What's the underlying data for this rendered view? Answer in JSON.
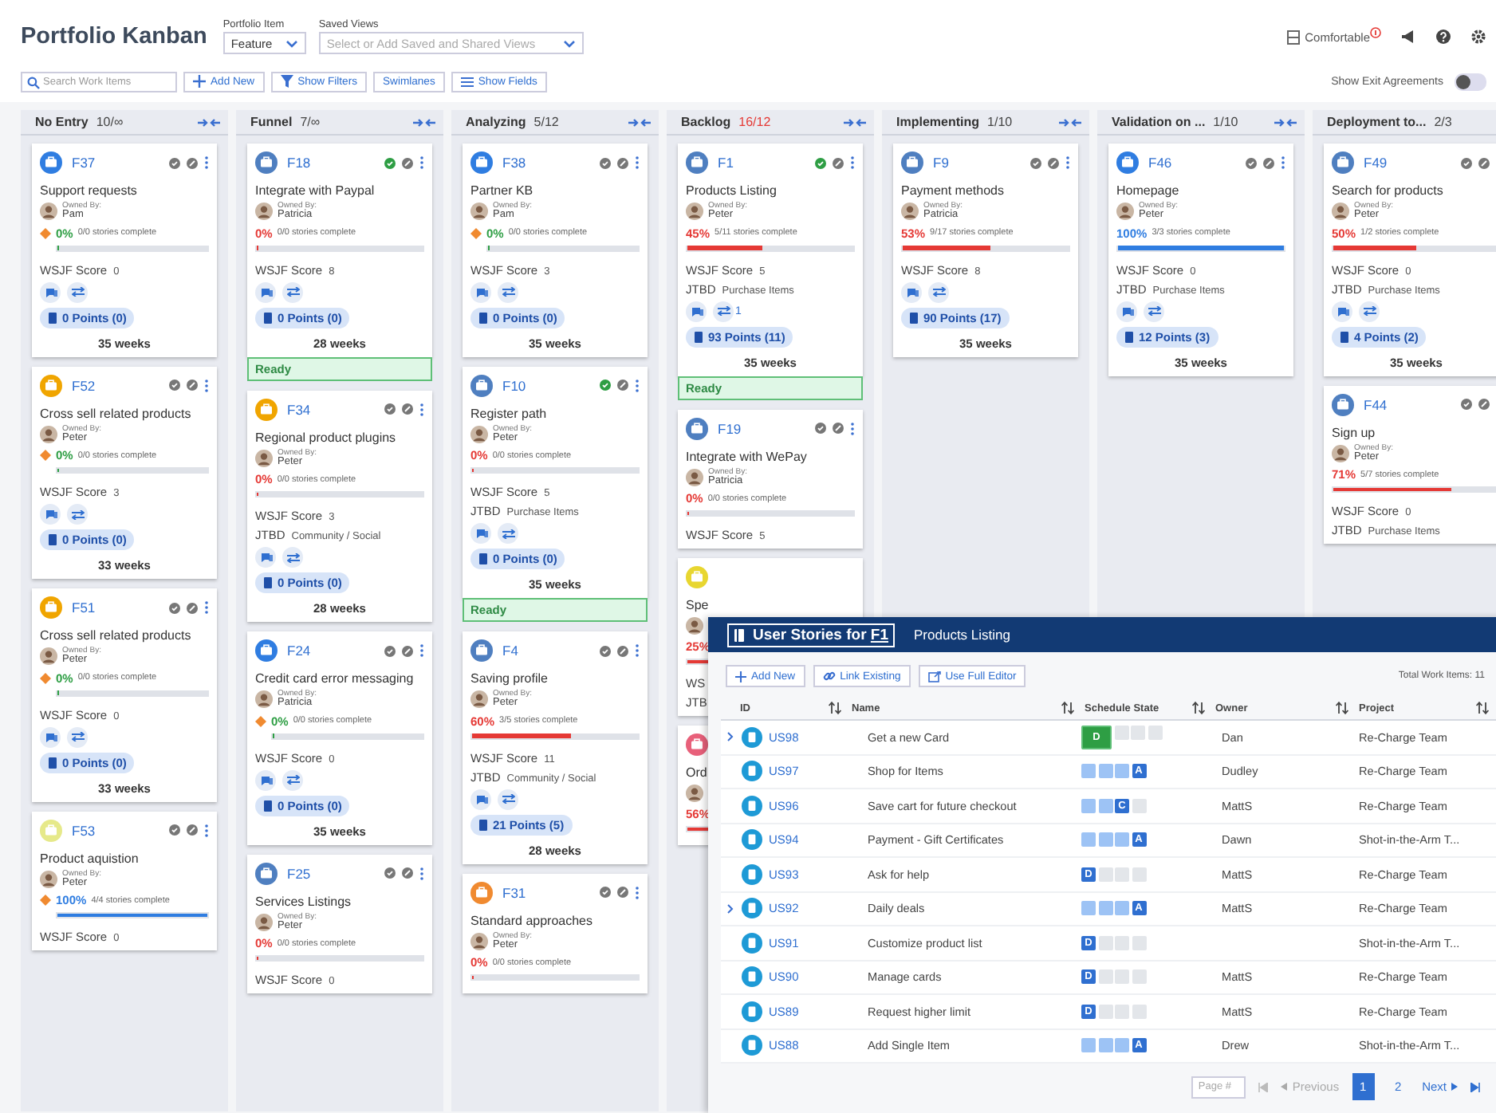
{
  "header": {
    "title": "Portfolio Kanban",
    "portfolio_item": {
      "label": "Portfolio Item",
      "value": "Feature"
    },
    "saved_views": {
      "label": "Saved Views",
      "placeholder": "Select or Add Saved and Shared Views"
    },
    "density": {
      "label": "Comfortable"
    }
  },
  "toolbar": {
    "search": {
      "placeholder": "Search Work Items"
    },
    "buttons": [
      {
        "label": "Add New",
        "kind": "plus"
      },
      {
        "label": "Show Filters",
        "kind": "filter"
      },
      {
        "label": "Swimlanes",
        "kind": "plain"
      },
      {
        "label": "Show Fields",
        "kind": "lines"
      }
    ],
    "exit_agreements": {
      "label": "Show Exit Agreements",
      "on": false
    }
  },
  "columns": [
    {
      "name": "No Entry",
      "count": "10/∞",
      "over_limit": false,
      "collapsible": true,
      "cards": [
        {
          "id": "F37",
          "color": "#2f7de1",
          "checked": false,
          "title": "Support requests",
          "owner_label": "Owned By:",
          "owner": "Pam",
          "risk": true,
          "progress": {
            "pct": "0%",
            "color": "#2e9e44",
            "stories": "0/0 stories complete",
            "level": 0
          },
          "wsjf_label": "WSJF Score",
          "wsjf": "0",
          "points": "0 Points (0)",
          "weeks": "35 weeks"
        },
        {
          "id": "F52",
          "color": "#f0a500",
          "checked": false,
          "title": "Cross sell related products",
          "owner_label": "Owned By:",
          "owner": "Peter",
          "risk": true,
          "progress": {
            "pct": "0%",
            "color": "#2e9e44",
            "stories": "0/0 stories complete",
            "level": 0
          },
          "wsjf_label": "WSJF Score",
          "wsjf": "3",
          "points": "0 Points (0)",
          "weeks": "33 weeks"
        },
        {
          "id": "F51",
          "color": "#f0a500",
          "checked": false,
          "title": "Cross sell related products",
          "owner_label": "Owned By:",
          "owner": "Peter",
          "risk": true,
          "progress": {
            "pct": "0%",
            "color": "#2e9e44",
            "stories": "0/0 stories complete",
            "level": 0
          },
          "wsjf_label": "WSJF Score",
          "wsjf": "0",
          "points": "0 Points (0)",
          "weeks": "33 weeks"
        },
        {
          "id": "F53",
          "color": "#e6e98a",
          "checked": false,
          "title": "Product aquistion",
          "owner_label": "Owned By:",
          "owner": "Peter",
          "risk": true,
          "progress": {
            "pct": "100%",
            "color": "#2f7de1",
            "stories": "4/4 stories complete",
            "level": 1
          },
          "wsjf_label": "WSJF Score",
          "wsjf": "0"
        }
      ]
    },
    {
      "name": "Funnel",
      "count": "7/∞",
      "over_limit": false,
      "collapsible": true,
      "cards": [
        {
          "id": "F18",
          "color": "#4f7fc0",
          "checked": true,
          "title": "Integrate with Paypal",
          "owner_label": "Owned By:",
          "owner": "Patricia",
          "risk": false,
          "progress": {
            "pct": "0%",
            "color": "#e53935",
            "stories": "0/0 stories complete",
            "level": 0
          },
          "wsjf_label": "WSJF Score",
          "wsjf": "8",
          "points": "0 Points (0)",
          "weeks": "28 weeks",
          "ready_label": "Ready"
        },
        {
          "id": "F34",
          "color": "#f0a500",
          "checked": false,
          "title": "Regional product plugins",
          "owner_label": "Owned By:",
          "owner": "Peter",
          "risk": false,
          "progress": {
            "pct": "0%",
            "color": "#e53935",
            "stories": "0/0 stories complete",
            "level": 0
          },
          "wsjf_label": "WSJF Score",
          "wsjf": "3",
          "jtbd_label": "JTBD",
          "jtbd": "Community / Social",
          "points": "0 Points (0)",
          "weeks": "28 weeks"
        },
        {
          "id": "F24",
          "color": "#2f7de1",
          "checked": false,
          "title": "Credit card error messaging",
          "owner_label": "Owned By:",
          "owner": "Patricia",
          "risk": true,
          "progress": {
            "pct": "0%",
            "color": "#2e9e44",
            "stories": "0/0 stories complete",
            "level": 0
          },
          "wsjf_label": "WSJF Score",
          "wsjf": "0",
          "points": "0 Points (0)",
          "weeks": "35 weeks"
        },
        {
          "id": "F25",
          "color": "#4f7fc0",
          "checked": false,
          "title": "Services Listings",
          "owner_label": "Owned By:",
          "owner": "Peter",
          "risk": false,
          "progress": {
            "pct": "0%",
            "color": "#e53935",
            "stories": "0/0 stories complete",
            "level": 0
          },
          "wsjf_label": "WSJF Score",
          "wsjf": "0"
        }
      ]
    },
    {
      "name": "Analyzing",
      "count": "5/12",
      "over_limit": false,
      "collapsible": true,
      "cards": [
        {
          "id": "F38",
          "color": "#2f7de1",
          "checked": false,
          "title": "Partner KB",
          "owner_label": "Owned By:",
          "owner": "Pam",
          "risk": true,
          "progress": {
            "pct": "0%",
            "color": "#2e9e44",
            "stories": "0/0 stories complete",
            "level": 0
          },
          "wsjf_label": "WSJF Score",
          "wsjf": "3",
          "points": "0 Points (0)",
          "weeks": "35 weeks"
        },
        {
          "id": "F10",
          "color": "#4f7fc0",
          "checked": true,
          "title": "Register path",
          "owner_label": "Owned By:",
          "owner": "Peter",
          "risk": false,
          "progress": {
            "pct": "0%",
            "color": "#e53935",
            "stories": "0/0 stories complete",
            "level": 0
          },
          "wsjf_label": "WSJF Score",
          "wsjf": "5",
          "jtbd_label": "JTBD",
          "jtbd": "Purchase Items",
          "points": "0 Points (0)",
          "weeks": "35 weeks",
          "ready_label": "Ready"
        },
        {
          "id": "F4",
          "color": "#4f7fc0",
          "checked": false,
          "title": "Saving profile",
          "owner_label": "Owned By:",
          "owner": "Peter",
          "risk": false,
          "progress": {
            "pct": "60%",
            "color": "#e53935",
            "stories": "3/5 stories complete",
            "level": 0.6
          },
          "wsjf_label": "WSJF Score",
          "wsjf": "11",
          "jtbd_label": "JTBD",
          "jtbd": "Community / Social",
          "points": "21 Points (5)",
          "weeks": "28 weeks"
        },
        {
          "id": "F31",
          "color": "#f08a30",
          "checked": false,
          "title": "Standard approaches",
          "owner_label": "Owned By:",
          "owner": "Peter",
          "risk": false,
          "progress": {
            "pct": "0%",
            "color": "#e53935",
            "stories": "0/0 stories complete",
            "level": 0
          }
        }
      ]
    },
    {
      "name": "Backlog",
      "count": "16/12",
      "over_limit": true,
      "collapsible": true,
      "cards": [
        {
          "id": "F1",
          "color": "#4f7fc0",
          "checked": true,
          "title": "Products Listing",
          "owner_label": "Owned By:",
          "owner": "Peter",
          "risk": false,
          "progress": {
            "pct": "45%",
            "color": "#e53935",
            "stories": "5/11 stories complete",
            "level": 0.45
          },
          "wsjf_label": "WSJF Score",
          "wsjf": "5",
          "jtbd_label": "JTBD",
          "jtbd": "Purchase Items",
          "dependency_count": "1",
          "points": "93 Points (11)",
          "weeks": "35 weeks",
          "ready_label": "Ready"
        },
        {
          "id": "F19",
          "color": "#4f7fc0",
          "checked": false,
          "title": "Integrate with WePay",
          "owner_label": "Owned By:",
          "owner": "Patricia",
          "risk": false,
          "progress": {
            "pct": "0%",
            "color": "#e53935",
            "stories": "0/0 stories complete",
            "level": 0
          },
          "wsjf_label": "WSJF Score",
          "wsjf": "5"
        },
        {
          "color": "#e8d630",
          "title": "Spe",
          "risk": false,
          "progress": {
            "pct": "25%",
            "color": "#e53935",
            "level": 0.25
          },
          "wsjf_label": "WS",
          "jtbd_label": "JTB"
        },
        {
          "color": "#e8607a",
          "title": "Ord",
          "risk": false,
          "progress": {
            "pct": "56%",
            "color": "#e53935",
            "level": 0.56
          }
        }
      ]
    },
    {
      "name": "Implementing",
      "count": "1/10",
      "over_limit": false,
      "collapsible": true,
      "cards": [
        {
          "id": "F9",
          "color": "#4f7fc0",
          "checked": false,
          "title": "Payment methods",
          "owner_label": "Owned By:",
          "owner": "Patricia",
          "risk": false,
          "progress": {
            "pct": "53%",
            "color": "#e53935",
            "stories": "9/17 stories complete",
            "level": 0.53
          },
          "wsjf_label": "WSJF Score",
          "wsjf": "8",
          "points": "90 Points (17)",
          "weeks": "35 weeks"
        }
      ]
    },
    {
      "name": "Validation on ...",
      "count": "1/10",
      "over_limit": false,
      "collapsible": true,
      "cards": [
        {
          "id": "F46",
          "color": "#2f7de1",
          "checked": false,
          "title": "Homepage",
          "owner_label": "Owned By:",
          "owner": "Peter",
          "risk": false,
          "progress": {
            "pct": "100%",
            "color": "#2f7de1",
            "stories": "3/3 stories complete",
            "level": 1
          },
          "wsjf_label": "WSJF Score",
          "wsjf": "0",
          "jtbd_label": "JTBD",
          "jtbd": "Purchase Items",
          "points": "12 Points (3)",
          "weeks": "35 weeks"
        }
      ]
    },
    {
      "name": "Deployment to...",
      "count": "2/3",
      "over_limit": false,
      "collapsible": false,
      "cards": [
        {
          "id": "F49",
          "color": "#4f7fc0",
          "checked": false,
          "title": "Search for products",
          "owner_label": "Owned By:",
          "owner": "Peter",
          "risk": false,
          "progress": {
            "pct": "50%",
            "color": "#e53935",
            "stories": "1/2 stories complete",
            "level": 0.5
          },
          "wsjf_label": "WSJF Score",
          "wsjf": "0",
          "jtbd_label": "JTBD",
          "jtbd": "Purchase Items",
          "points": "4 Points (2)",
          "weeks": "35 weeks"
        },
        {
          "id": "F44",
          "color": "#4f7fc0",
          "checked": false,
          "title": "Sign up",
          "owner_label": "Owned By:",
          "owner": "Peter",
          "risk": false,
          "progress": {
            "pct": "71%",
            "color": "#e53935",
            "stories": "5/7 stories complete",
            "level": 0.71
          },
          "wsjf_label": "WSJF Score",
          "wsjf": "0",
          "jtbd_label": "JTBD",
          "jtbd": "Purchase Items"
        }
      ]
    }
  ],
  "panel": {
    "title": "User Stories for",
    "title_ref": "F1",
    "subtitle": "Products Listing",
    "buttons": [
      {
        "label": "Add New",
        "kind": "plus"
      },
      {
        "label": "Link Existing",
        "kind": "link"
      },
      {
        "label": "Use Full Editor",
        "kind": "external"
      }
    ],
    "total": "Total Work Items: 11",
    "table": {
      "columns": [
        {
          "label": "ID",
          "sortable": true
        },
        {
          "label": "Name",
          "sortable": true
        },
        {
          "label": "Schedule State",
          "sortable": true
        },
        {
          "label": "Owner",
          "sortable": true
        },
        {
          "label": "Project",
          "sortable": true
        }
      ],
      "rows": [
        {
          "expandable": true,
          "id": "US98",
          "name": "Get a new Card",
          "state": {
            "letter": "D",
            "kind": "defined",
            "ready": true
          },
          "owner": "Dan",
          "project": "Re-Charge Team"
        },
        {
          "expandable": false,
          "id": "US97",
          "name": "Shop for Items",
          "state": {
            "letter": "A",
            "kind": "accepted",
            "ready": false
          },
          "owner": "Dudley",
          "project": "Re-Charge Team"
        },
        {
          "expandable": false,
          "id": "US96",
          "name": "Save cart for future checkout",
          "state": {
            "letter": "C",
            "kind": "completed",
            "ready": false
          },
          "owner": "MattS",
          "project": "Re-Charge Team"
        },
        {
          "expandable": false,
          "id": "US94",
          "name": "Payment - Gift Certificates",
          "state": {
            "letter": "A",
            "kind": "accepted",
            "ready": false
          },
          "owner": "Dawn",
          "project": "Shot-in-the-Arm T..."
        },
        {
          "expandable": false,
          "id": "US93",
          "name": "Ask for help",
          "state": {
            "letter": "D",
            "kind": "defined",
            "ready": false
          },
          "owner": "MattS",
          "project": "Re-Charge Team"
        },
        {
          "expandable": true,
          "id": "US92",
          "name": "Daily deals",
          "state": {
            "letter": "A",
            "kind": "accepted",
            "ready": false
          },
          "owner": "MattS",
          "project": "Re-Charge Team"
        },
        {
          "expandable": false,
          "id": "US91",
          "name": "Customize product list",
          "state": {
            "letter": "D",
            "kind": "defined",
            "ready": false
          },
          "project": "Shot-in-the-Arm T..."
        },
        {
          "expandable": false,
          "id": "US90",
          "name": "Manage cards",
          "state": {
            "letter": "D",
            "kind": "defined",
            "ready": false
          },
          "owner": "MattS",
          "project": "Re-Charge Team"
        },
        {
          "expandable": false,
          "id": "US89",
          "name": "Request higher limit",
          "state": {
            "letter": "D",
            "kind": "defined",
            "ready": false
          },
          "owner": "MattS",
          "project": "Re-Charge Team"
        },
        {
          "expandable": false,
          "id": "US88",
          "name": "Add Single Item",
          "state": {
            "letter": "A",
            "kind": "accepted",
            "ready": false
          },
          "owner": "Drew",
          "project": "Shot-in-the-Arm T..."
        }
      ]
    },
    "pagination": {
      "placeholder": "Page #",
      "previous": {
        "label": "Previous",
        "disabled": true
      },
      "pages": [
        {
          "label": "1",
          "selected": true
        },
        {
          "label": "2",
          "selected": false
        }
      ],
      "next": {
        "label": "Next",
        "disabled": false
      }
    }
  }
}
